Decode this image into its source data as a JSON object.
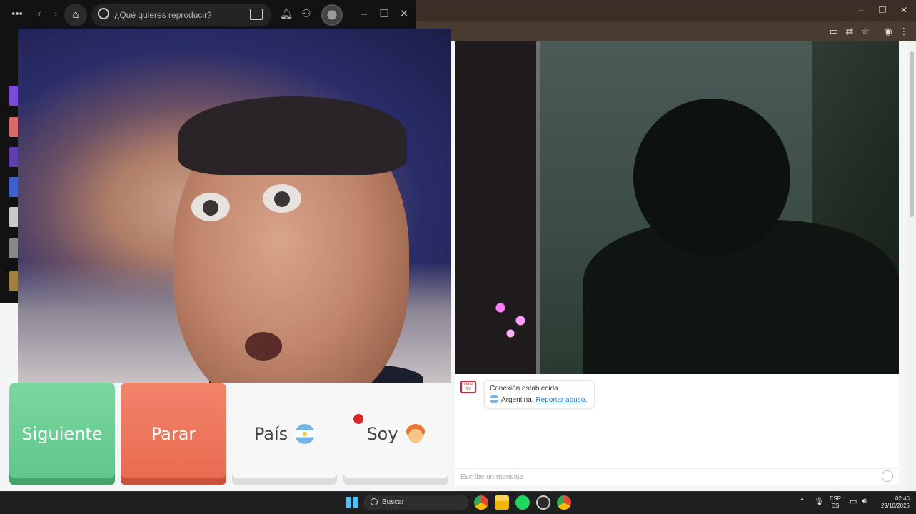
{
  "spotify": {
    "search_placeholder": "¿Qué quieres reproducir?",
    "menu_icon": "more-dots-icon",
    "window_controls": [
      "–",
      "☐",
      "✕"
    ]
  },
  "browser": {
    "window_controls": [
      "–",
      "❐",
      "✕"
    ]
  },
  "controls": {
    "next_label": "Siguiente",
    "stop_label": "Parar",
    "country_label": "País",
    "gender_label": "Soy"
  },
  "chat": {
    "logo_text": "Ome TV",
    "status": "Conexión establecida.",
    "country": "Argentina.",
    "report_link": "Reportar abuso",
    "report_suffix": ".",
    "input_placeholder": "Escribe un mensaje"
  },
  "taskbar": {
    "search_label": "Buscar",
    "lang_top": "ESP",
    "lang_bottom": "ES",
    "time": "02:46",
    "date": "29/10/2025"
  },
  "colors": {
    "next": "#5fc58a",
    "stop": "#e8694f",
    "spotify_bg": "#121212",
    "report_link": "#2a7fc2"
  }
}
